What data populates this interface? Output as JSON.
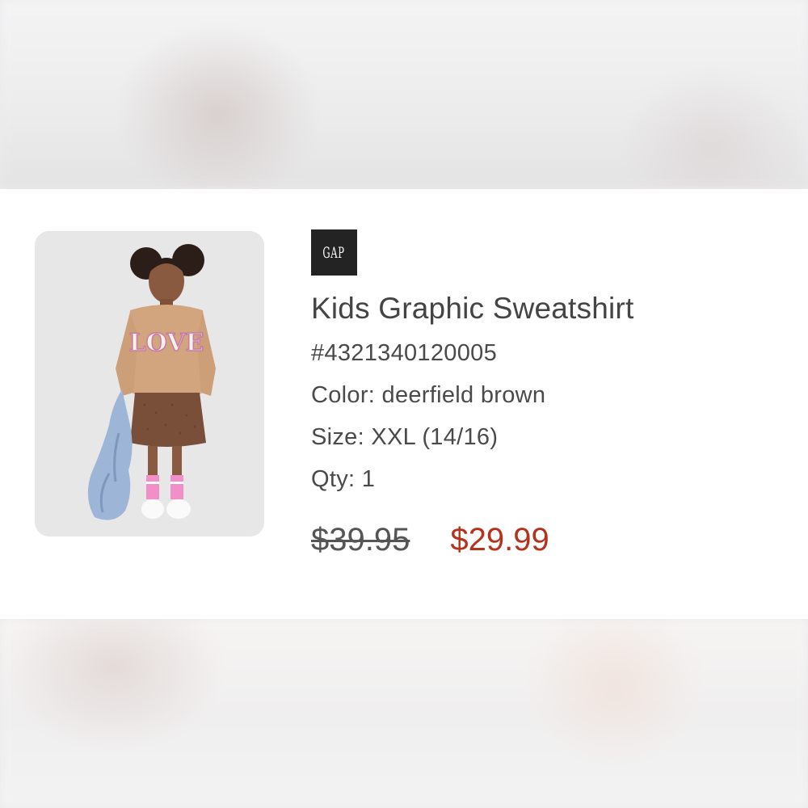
{
  "product": {
    "brand": "GAP",
    "image_alt": "Kids Graphic Sweatshirt",
    "sweatshirt_text": "LOVE",
    "name": "Kids Graphic Sweatshirt",
    "sku": "#4321340120005",
    "color_line": "Color: deerfield brown",
    "size_line": "Size: XXL (14/16)",
    "qty_line": "Qty: 1",
    "price_original": "$39.95",
    "price_sale": "$29.99"
  },
  "colors": {
    "sale": "#b5321c",
    "text": "#444444",
    "brand_bg": "#232323"
  }
}
